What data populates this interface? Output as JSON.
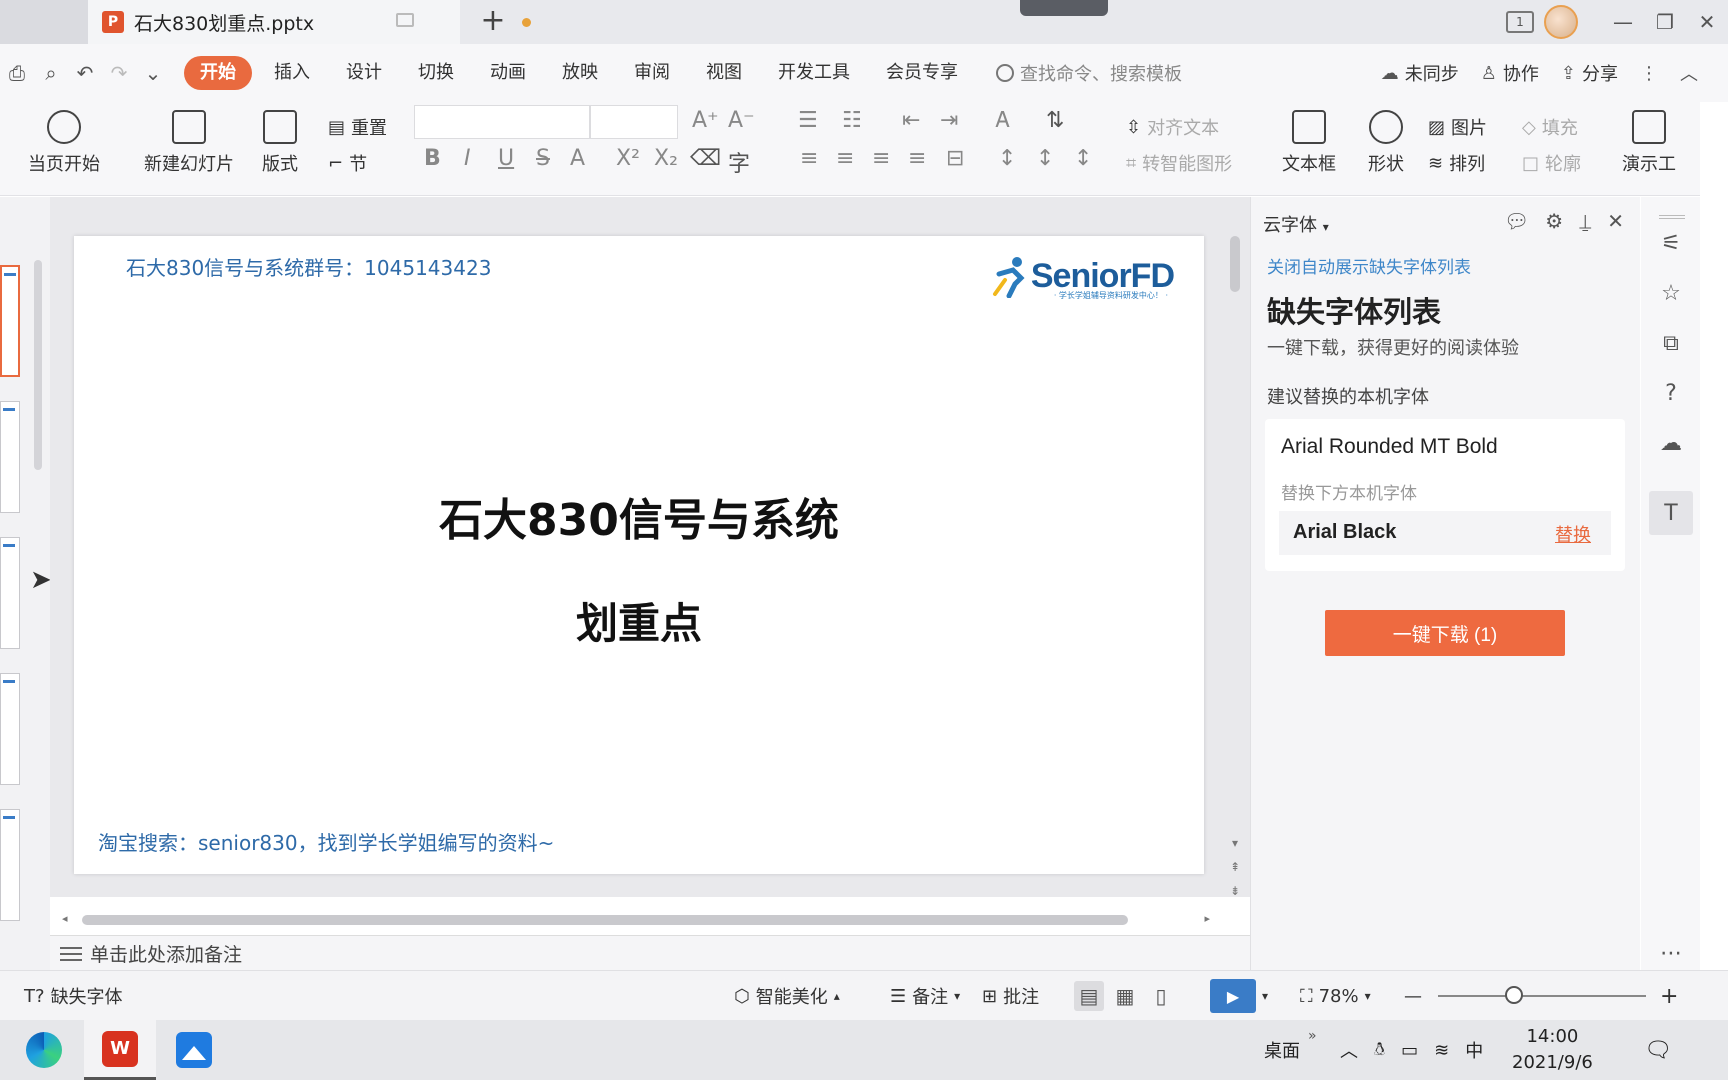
{
  "window": {
    "doc_tab_title": "石大830划重点.pptx",
    "new_tab_symbol": "+",
    "badge_number": "1"
  },
  "menu": {
    "quick_access": [
      "print-icon",
      "preview-icon",
      "undo-icon",
      "redo-icon",
      "more-icon"
    ],
    "tabs": [
      "开始",
      "插入",
      "设计",
      "切换",
      "动画",
      "放映",
      "审阅",
      "视图",
      "开发工具",
      "会员专享"
    ],
    "search_placeholder": "查找命令、搜索模板",
    "sync": "未同步",
    "collab": "协作",
    "share": "分享"
  },
  "ribbon": {
    "play_from_current": "当页开始",
    "new_slide": "新建幻灯片",
    "layout": "版式",
    "reset": "重置",
    "section": "节",
    "align_text": "对齐文本",
    "smart_art": "转智能图形",
    "textbox": "文本框",
    "shape": "形状",
    "picture": "图片",
    "fill": "填充",
    "arrange": "排列",
    "outline": "轮廓",
    "demo_tools": "演示工",
    "format_bold": "B",
    "format_italic": "I",
    "format_underline": "U",
    "format_strike": "S",
    "format_fontcolor": "A",
    "format_super": "X²",
    "format_sub": "X₂",
    "font_grow": "A⁺",
    "font_shrink": "A⁻"
  },
  "slide": {
    "top_note": "石大830信号与系统群号：1045143423",
    "logo_text": "SeniorFD",
    "logo_sub": "· 学长学姐辅导资料研发中心！ ·",
    "title_line1": "石大830信号与系统",
    "title_line2": "划重点",
    "bottom_note": "淘宝搜索：senior830，找到学长学姐编写的资料~"
  },
  "notes": {
    "placeholder": "单击此处添加备注"
  },
  "panel": {
    "header": "云字体",
    "close_auto": "关闭自动展示缺失字体列表",
    "title": "缺失字体列表",
    "subtitle": "一键下载，获得更好的阅读体验",
    "section": "建议替换的本机字体",
    "missing_font": "Arial Rounded MT Bold",
    "replace_hint": "替换下方本机字体",
    "replacement_font": "Arial Black",
    "replace_link": "替换",
    "download_button": "一键下载 (1)"
  },
  "statusbar": {
    "missing_fonts": "缺失字体",
    "smart_beautify": "智能美化",
    "notes": "备注",
    "comments": "批注",
    "zoom": "78%"
  },
  "taskbar": {
    "desktop": "桌面",
    "ime": "中",
    "time": "14:00",
    "date": "2021/9/6"
  },
  "colors": {
    "accent_orange": "#e96a3f",
    "link_blue": "#3f87c9",
    "slide_text_blue": "#2e6aa8"
  }
}
